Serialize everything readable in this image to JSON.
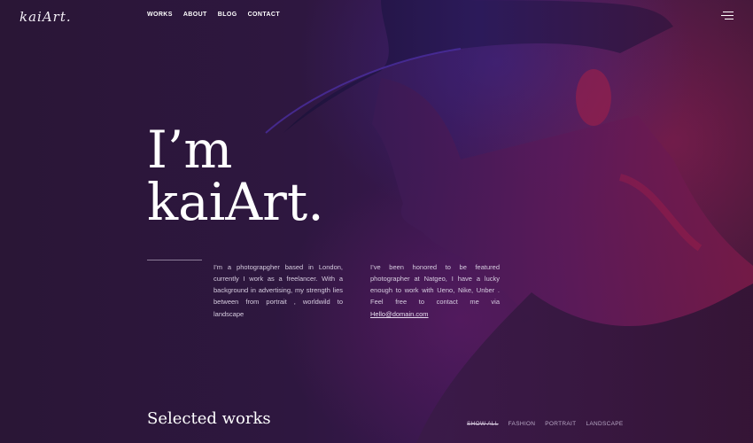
{
  "brand": {
    "logo_text": "kaiArt."
  },
  "nav": {
    "items": [
      "WORKS",
      "ABOUT",
      "BLOG",
      "CONTACT"
    ]
  },
  "hero": {
    "title_line1": "I’m",
    "title_line2": "kaiArt.",
    "intro_left": "I’m a photograpgher based in London, currently I work as a freelancer. With a background in advertising, my strength lies between from portrait , worldwild to landscape",
    "intro_right": "I’ve been honored to be featured photographer at Natgeo, I have a lucky enough to work with Ueno, Nike, Unber . Feel free to contact me via",
    "email": "Hello@domain.com"
  },
  "works": {
    "title": "Selected works",
    "filters": [
      "SHOW ALL",
      "FASHION",
      "PORTRAIT",
      "LANDSCAPE"
    ],
    "active_filter": "SHOW ALL"
  },
  "icons": {
    "menu": "hamburger-menu-icon"
  },
  "colors": {
    "background": "#2a1636",
    "accent_red": "#9a1c4a",
    "accent_blue": "#3b2a8c",
    "text": "#ffffff",
    "muted_text": "#d7cde0"
  }
}
